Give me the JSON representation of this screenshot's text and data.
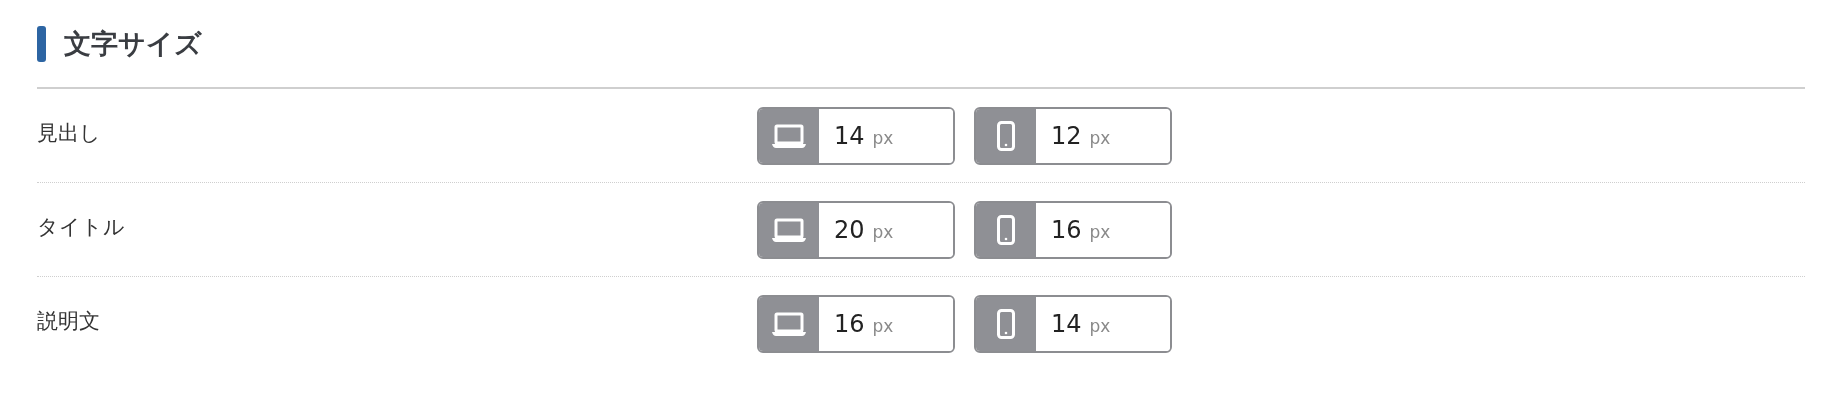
{
  "section": {
    "title": "文字サイズ"
  },
  "rows": [
    {
      "label": "見出し",
      "inputs": [
        {
          "kind": "desktop",
          "value": "14",
          "unit": "px"
        },
        {
          "kind": "mobile",
          "value": "12",
          "unit": "px"
        }
      ]
    },
    {
      "label": "タイトル",
      "inputs": [
        {
          "kind": "desktop",
          "value": "20",
          "unit": "px"
        },
        {
          "kind": "mobile",
          "value": "16",
          "unit": "px"
        }
      ]
    },
    {
      "label": "説明文",
      "inputs": [
        {
          "kind": "desktop",
          "value": "16",
          "unit": "px"
        },
        {
          "kind": "mobile",
          "value": "14",
          "unit": "px"
        }
      ]
    }
  ]
}
